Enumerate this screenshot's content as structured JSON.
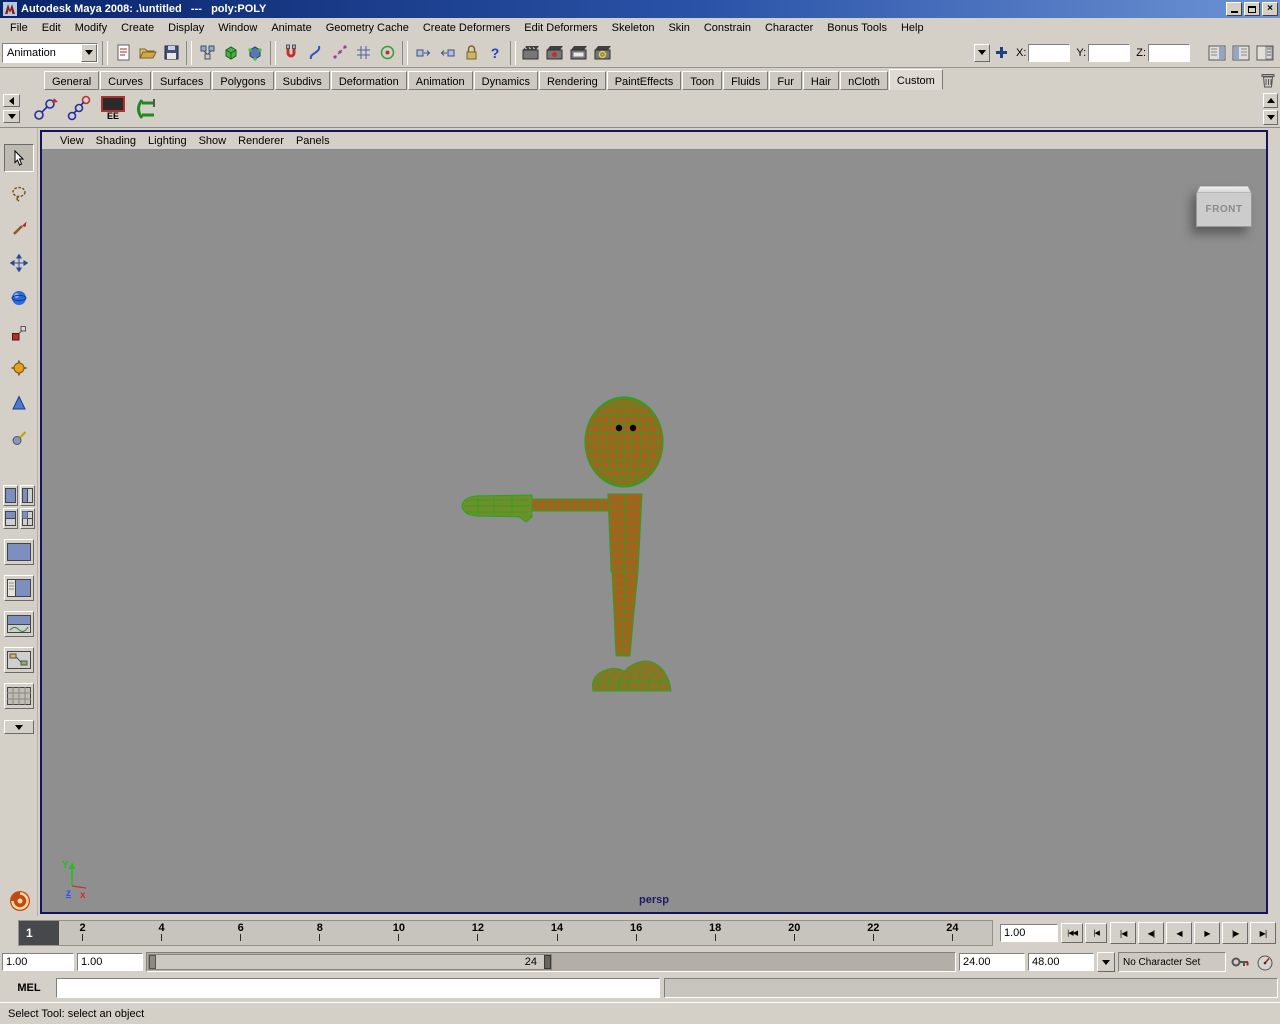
{
  "window": {
    "title": "Autodesk Maya 2008: .\\untitled   ---   poly:POLY",
    "close_glyph": "×"
  },
  "menubar": {
    "items": [
      "File",
      "Edit",
      "Modify",
      "Create",
      "Display",
      "Window",
      "Animate",
      "Geometry Cache",
      "Create Deformers",
      "Edit Deformers",
      "Skeleton",
      "Skin",
      "Constrain",
      "Character",
      "Bonus Tools",
      "Help"
    ]
  },
  "statusline": {
    "menuset_value": "Animation",
    "x_label": "X:",
    "y_label": "Y:",
    "z_label": "Z:",
    "x_value": "",
    "y_value": "",
    "z_value": ""
  },
  "shelf": {
    "tabs": [
      "General",
      "Curves",
      "Surfaces",
      "Polygons",
      "Subdivs",
      "Deformation",
      "Animation",
      "Dynamics",
      "Rendering",
      "PaintEffects",
      "Toon",
      "Fluids",
      "Fur",
      "Hair",
      "nCloth",
      "Custom"
    ],
    "active_tab": "Custom",
    "ee_label": "EE"
  },
  "panel_menu": {
    "items": [
      "View",
      "Shading",
      "Lighting",
      "Show",
      "Renderer",
      "Panels"
    ]
  },
  "viewport": {
    "camera_label": "persp",
    "viewcube_label": "FRONT",
    "axis_y": "Y",
    "axis_z": "z",
    "axis_x": "x"
  },
  "timeline": {
    "current_frame": "1",
    "ticks": [
      "2",
      "4",
      "6",
      "8",
      "10",
      "12",
      "14",
      "16",
      "18",
      "20",
      "22",
      "24"
    ],
    "current_time": "1.00",
    "small_transport": [
      "|◀◀",
      "|◀"
    ],
    "transport": [
      "|◀",
      "◀|",
      "◀",
      "▶",
      "|▶",
      "▶|"
    ]
  },
  "range_slider": {
    "anim_start": "1.00",
    "playback_start": "1.00",
    "range_end_label": "24",
    "playback_end": "24.00",
    "anim_end": "48.00",
    "character_set": "No Character Set"
  },
  "command_line": {
    "label": "MEL",
    "input_value": ""
  },
  "help_line": {
    "text": "Select Tool: select an object"
  },
  "icons": {
    "question_glyph": "?"
  },
  "colors": {
    "titlebar_blue": "#0a246a",
    "ui_gray": "#d4d0c8",
    "viewport_gray": "#8f8f8f",
    "wireframe_green": "#25a425",
    "body_orange": "#a8611d"
  }
}
